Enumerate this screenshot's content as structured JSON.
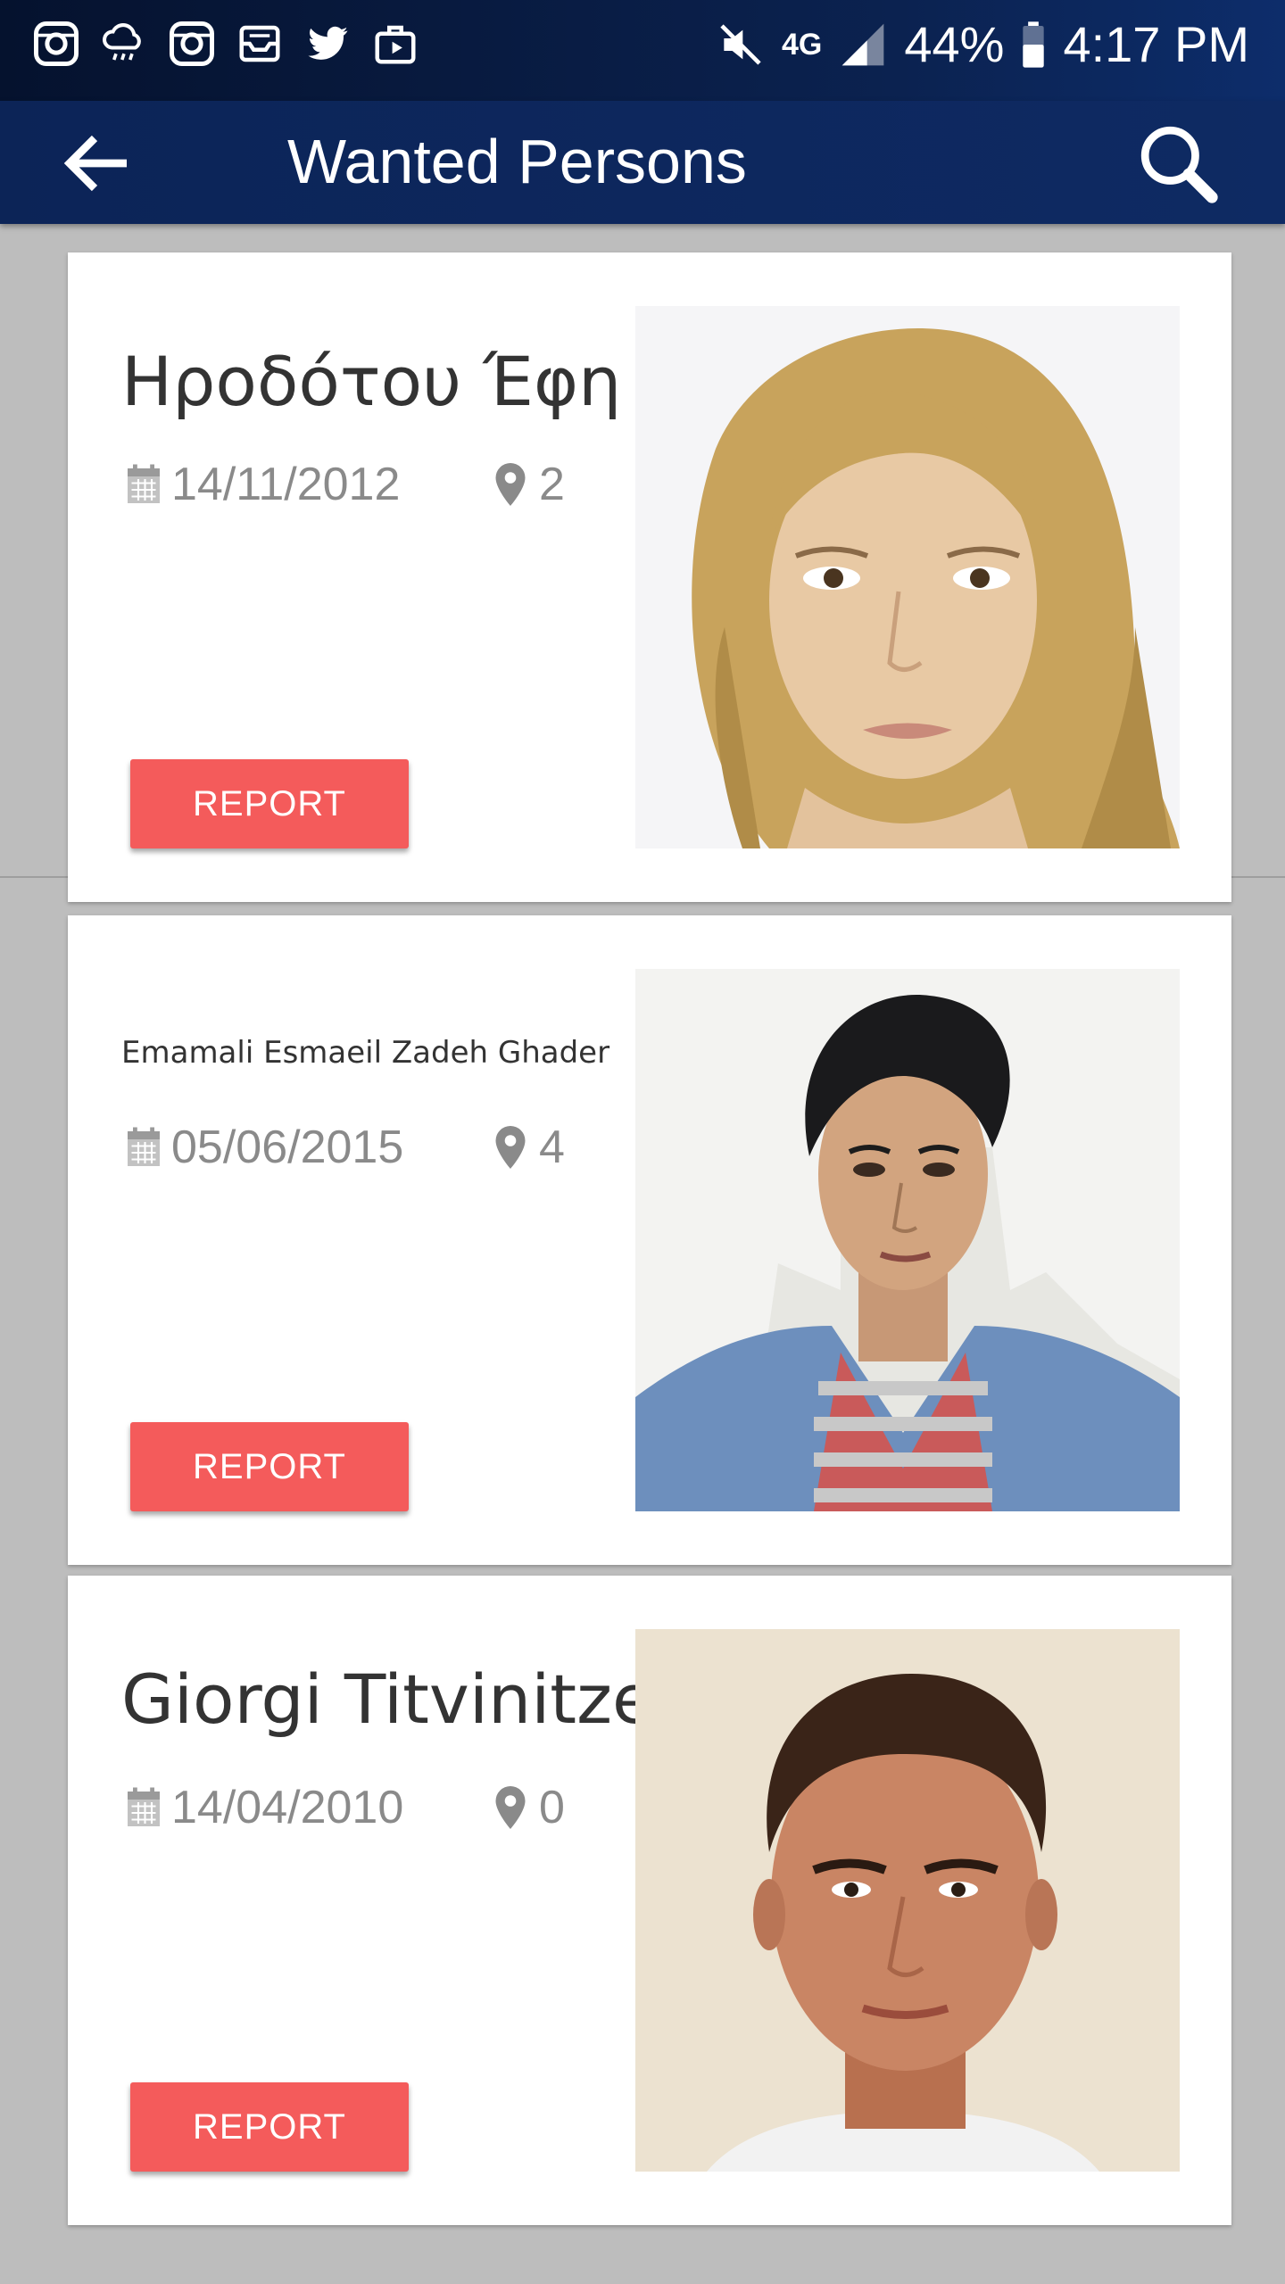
{
  "status_bar": {
    "left_icons": [
      "instagram-icon",
      "cloud-rain-icon",
      "instagram-icon",
      "mail-icon",
      "twitter-icon",
      "briefcase-play-icon"
    ],
    "right_icons": [
      "mute-icon",
      "lte-signal-icon",
      "signal-icon",
      "battery-icon"
    ],
    "network": "4G",
    "battery": "44%",
    "time": "4:17 PM"
  },
  "app_bar": {
    "title": "Wanted Persons",
    "back_icon": "arrow-back-icon",
    "search_icon": "search-icon"
  },
  "persons": [
    {
      "name": "Ηροδότου Έφη",
      "date": "14/11/2012",
      "count": "2",
      "report_label": "REPORT"
    },
    {
      "name": "Emamali Esmaeil Zadeh Ghader",
      "date": "05/06/2015",
      "count": "4",
      "report_label": "REPORT"
    },
    {
      "name": "Giorgi Titvinitze",
      "date": "14/04/2010",
      "count": "0",
      "report_label": "REPORT"
    }
  ],
  "colors": {
    "status_bar": "#05122e",
    "app_bar": "#0c2457",
    "report_button": "#f45b5b",
    "background": "#bdbdbd"
  }
}
